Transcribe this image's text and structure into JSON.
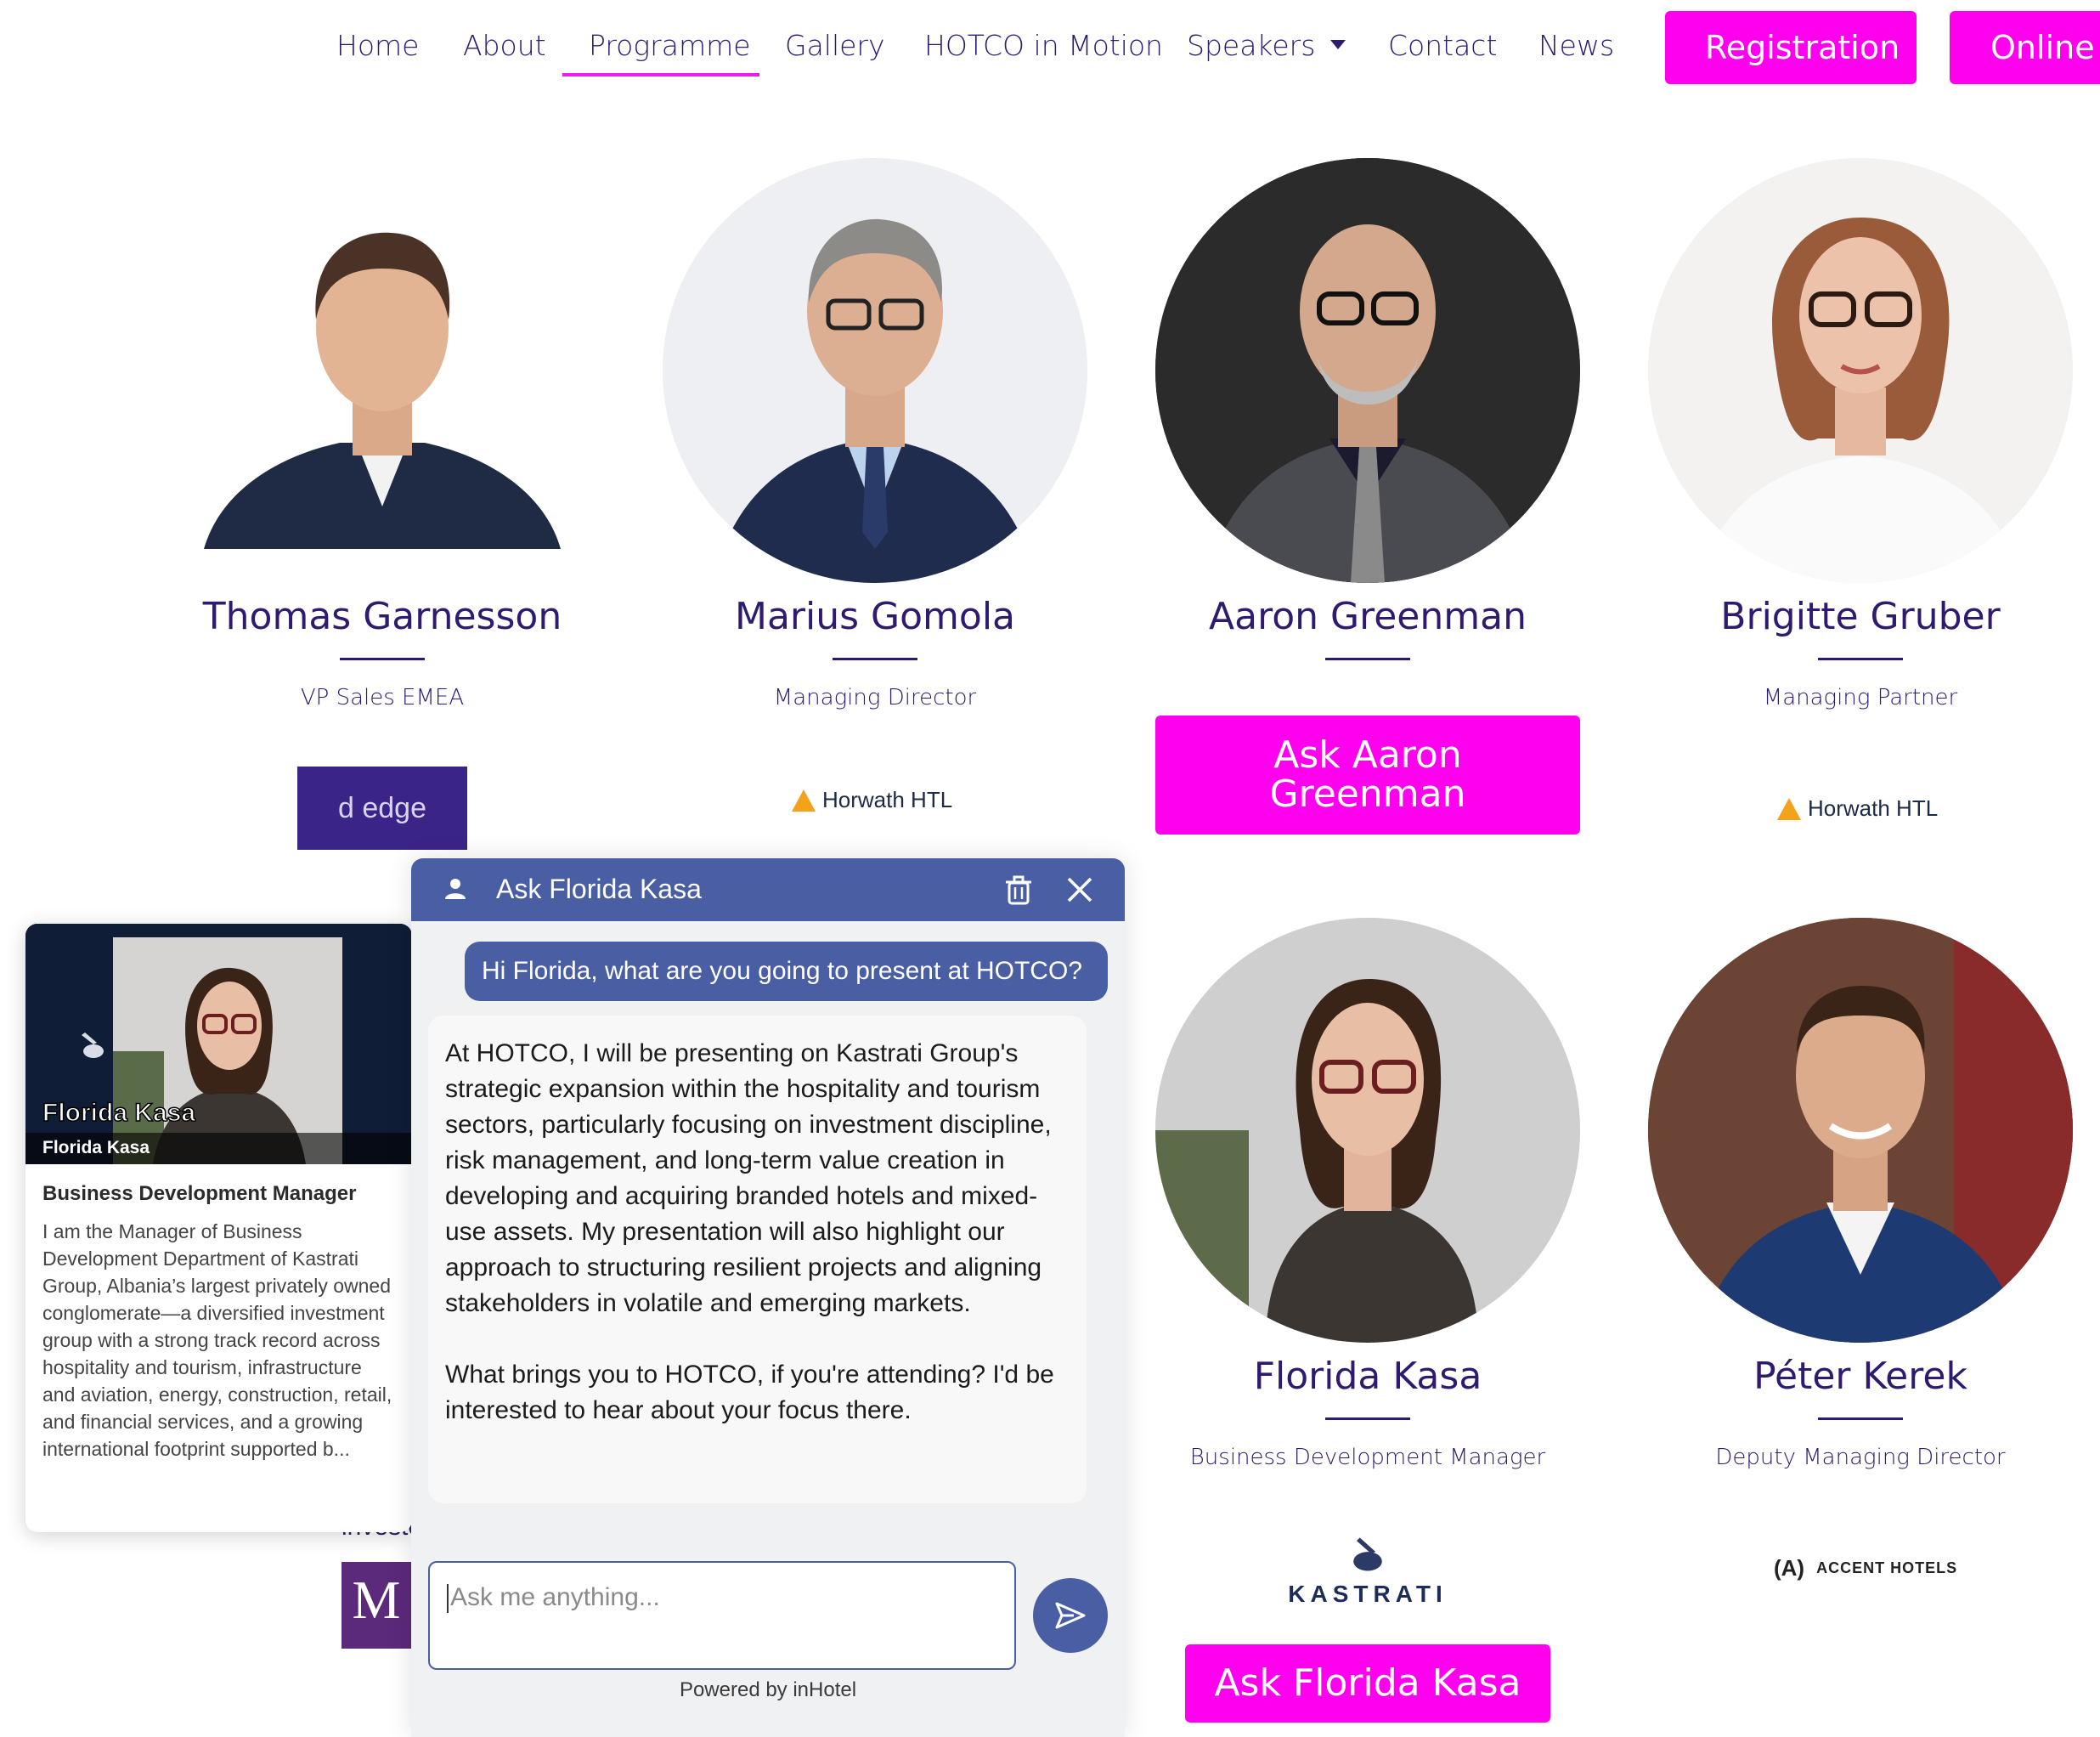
{
  "nav": {
    "links": [
      "Home",
      "About",
      "Programme",
      "Gallery",
      "HOTCO in Motion",
      "Speakers",
      "Contact",
      "News"
    ],
    "registration_label": "Registration",
    "online_label": "Online E",
    "active": "Programme",
    "accent_color": "#ff00ee"
  },
  "speakers": [
    {
      "name": "Thomas Garnesson",
      "title": "VP Sales EMEA",
      "logo": "d-edge"
    },
    {
      "name": "Marius Gomola",
      "title": "Managing Director",
      "logo": "Horwath HTL"
    },
    {
      "name": "Aaron Greenman",
      "title": "",
      "button": "Ask Aaron Greenman"
    },
    {
      "name": "Brigitte Gruber",
      "title": "Managing Partner",
      "logo": "Horwath HTL"
    },
    {
      "name": "Florida Kasa",
      "title": "Business Development Manager",
      "logo": "KASTRATI",
      "button": "Ask Florida Kasa"
    },
    {
      "name": "Péter Kerek",
      "title": "Deputy Managing Director",
      "logo": "ACCENT HOTELS"
    }
  ],
  "logos": {
    "dedge_text": "d edge",
    "horwath_text": "Horwath HTL",
    "kastrati_text": "KASTRATI",
    "accent_mark": "(A)",
    "accent_text": "ACCENT HOTELS"
  },
  "chat": {
    "title": "Ask Florida Kasa",
    "user_message": "Hi Florida, what are you going to present at HOTCO?",
    "bot_message_1": "At HOTCO, I will be presenting on Kastrati Group's strategic expansion within the hospitality and tourism sectors, particularly focusing on investment discipline, risk management, and long-term value creation in developing and acquiring branded hotels and mixed-use assets. My presentation will also highlight our approach to structuring resilient projects and aligning stakeholders in volatile and emerging markets.",
    "bot_message_2": "What brings you to HOTCO, if you're attending? I'd be interested to hear about your focus there.",
    "input_placeholder": "Ask me anything...",
    "powered_by": "Powered by inHotel",
    "header_color": "#4a5ea4"
  },
  "profile_card": {
    "name_overlay": "Florida Kasa",
    "name_strip": "Florida Kasa",
    "role": "Business Development Manager",
    "bio": "I am the Manager of Business Development Department of Kastrati Group, Albania’s largest privately owned conglomerate—a diversified investment group with a strong track record across hospitality and tourism, infrastructure and aviation, energy, construction, retail, and financial services, and a growing international footprint supported b..."
  },
  "background_fragments": {
    "partial_text": "investe",
    "mellow_letter": "M"
  }
}
